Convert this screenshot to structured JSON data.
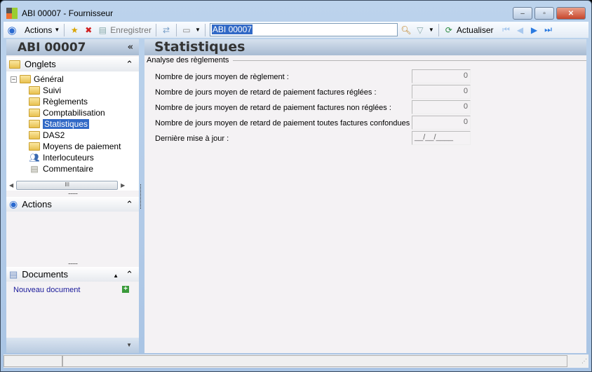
{
  "window": {
    "title": "ABI 00007 -  Fournisseur",
    "minimize": "–",
    "maximize": "▫",
    "close": "✕"
  },
  "toolbar": {
    "actions": "Actions",
    "save": "Enregistrer",
    "search_value": "ABI 00007",
    "refresh": "Actualiser"
  },
  "left": {
    "title": "ABI 00007",
    "collapse": "«",
    "onglets": {
      "label": "Onglets",
      "toggle": "⌃"
    },
    "tree": [
      {
        "label": "Général"
      },
      {
        "label": "Suivi"
      },
      {
        "label": "Règlements"
      },
      {
        "label": "Comptabilisation"
      },
      {
        "label": "Statistiques"
      },
      {
        "label": "DAS2"
      },
      {
        "label": "Moyens de paiement"
      },
      {
        "label": "Interlocuteurs"
      },
      {
        "label": "Commentaire"
      }
    ],
    "scroll_grip": "III",
    "actions": {
      "label": "Actions",
      "toggle": "⌃"
    },
    "documents": {
      "label": "Documents",
      "toggle": "⌃",
      "new": "Nouveau document"
    }
  },
  "main": {
    "title": "Statistiques",
    "group": "Analyse des règlements",
    "fields": [
      {
        "label": "Nombre de jours moyen de règlement :",
        "value": "0"
      },
      {
        "label": "Nombre de jours moyen de retard de paiement factures réglées :",
        "value": "0"
      },
      {
        "label": "Nombre de jours moyen de retard de paiement factures non réglées :",
        "value": "0"
      },
      {
        "label": "Nombre de jours moyen de retard de paiement toutes factures confondues :",
        "value": "0"
      },
      {
        "label": "Dernière mise à jour :",
        "value": "__/__/____"
      }
    ]
  }
}
